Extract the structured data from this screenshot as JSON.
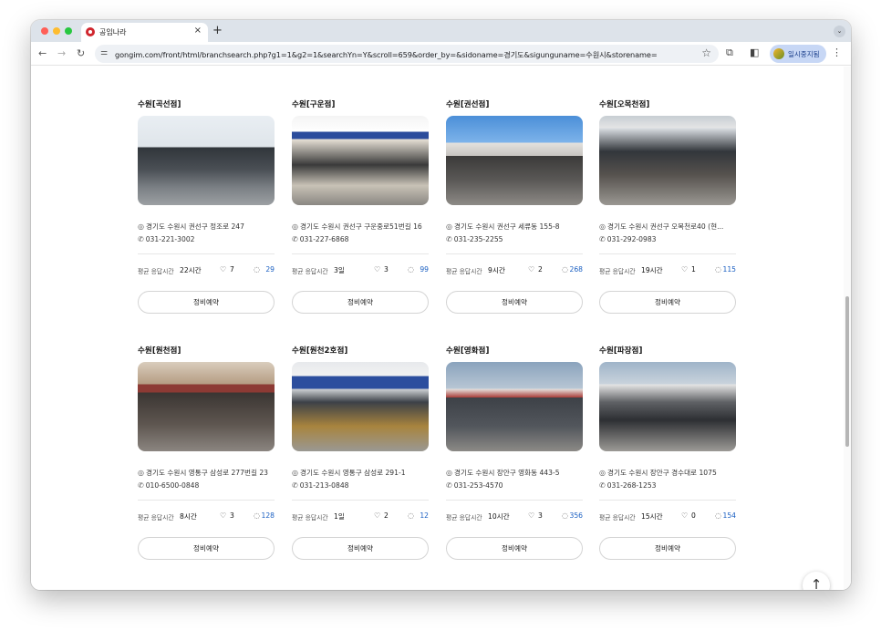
{
  "browser": {
    "tab_title": "공임나라",
    "tab_close": "×",
    "new_tab": "+",
    "url": "gongim.com/front/html/branchsearch.php?g1=1&g2=1&searchYn=Y&scroll=659&order_by=&sidoname=경기도&sigunguname=수원시&storename=",
    "profile_label": "일시중지됨",
    "icons": [
      "back-arrow",
      "forward-arrow",
      "reload",
      "tune",
      "star",
      "extensions",
      "sidepanel",
      "menu"
    ]
  },
  "labels": {
    "avg_response": "평균 응답시간",
    "reserve_button": "정비예약"
  },
  "branches": [
    {
      "name": "수원[곡선점]",
      "address": "경기도 수원시 권선구 정조로 247",
      "phone": "031-221-3002",
      "response": "22시간",
      "likes": "7",
      "reviews": "29"
    },
    {
      "name": "수원[구운점]",
      "address": "경기도 수원시 권선구 구운중로51번길 16",
      "phone": "031-227-6868",
      "response": "3일",
      "likes": "3",
      "reviews": "99"
    },
    {
      "name": "수원[권선점]",
      "address": "경기도 수원시 권선구 세류동 155-8",
      "phone": "031-235-2255",
      "response": "9시간",
      "likes": "2",
      "reviews": "268"
    },
    {
      "name": "수원[오목천점]",
      "address": "경기도 수원시 권선구 오목천로40 (현...",
      "phone": "031-292-0983",
      "response": "19시간",
      "likes": "1",
      "reviews": "115"
    },
    {
      "name": "수원[원천점]",
      "address": "경기도 수원시 영통구 삼성로 277번길 23",
      "phone": "010-6500-0848",
      "response": "8시간",
      "likes": "3",
      "reviews": "128"
    },
    {
      "name": "수원[원천2호점]",
      "address": "경기도 수원시 영통구 삼성로 291-1",
      "phone": "031-213-0848",
      "response": "1일",
      "likes": "2",
      "reviews": "12"
    },
    {
      "name": "수원[영화점]",
      "address": "경기도 수원시 장안구 영화동 443-5",
      "phone": "031-253-4570",
      "response": "10시간",
      "likes": "3",
      "reviews": "356"
    },
    {
      "name": "수원[파장점]",
      "address": "경기도 수원시 장안구 경수대로 1075",
      "phone": "031-268-1253",
      "response": "15시간",
      "likes": "0",
      "reviews": "154"
    }
  ],
  "scroll_top_icon": "arrow-up-icon"
}
